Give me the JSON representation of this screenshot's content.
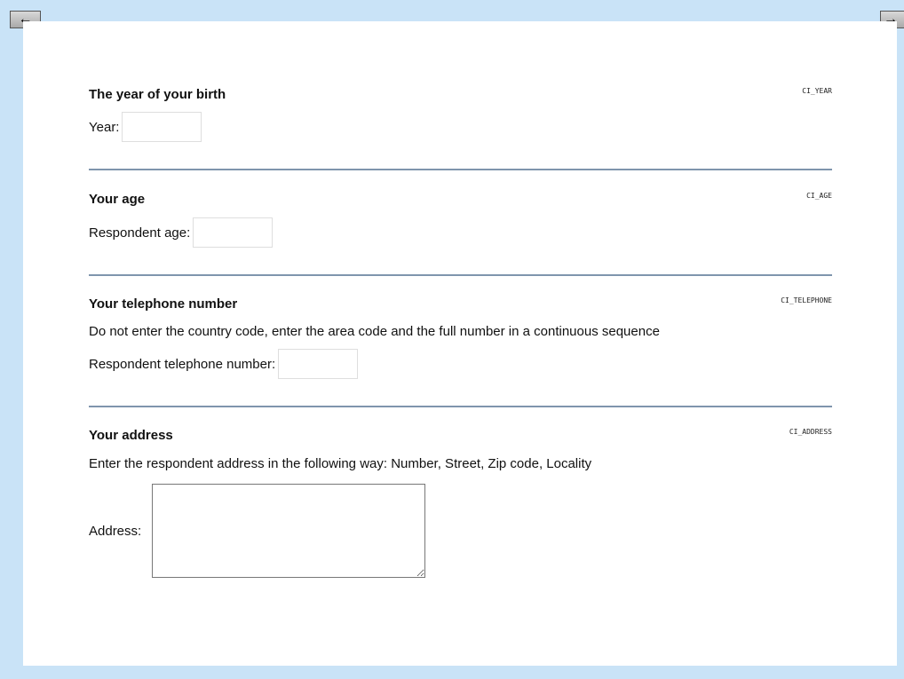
{
  "nav": {
    "prev_icon": "arrow-left-icon",
    "next_icon": "arrow-right-icon",
    "prev_glyph": "←",
    "next_glyph": "→"
  },
  "questions": {
    "year": {
      "title": "The year of your birth",
      "code": "CI_YEAR",
      "label": "Year:",
      "value": ""
    },
    "age": {
      "title": "Your age",
      "code": "CI_AGE",
      "label": "Respondent age:",
      "value": ""
    },
    "telephone": {
      "title": "Your telephone number",
      "code": "CI_TELEPHONE",
      "description": "Do not enter the country code, enter the area code and the full number in a continuous sequence",
      "label": "Respondent telephone number:",
      "value": ""
    },
    "address": {
      "title": "Your address",
      "code": "CI_ADDRESS",
      "description": "Enter the respondent address in the following way: Number, Street, Zip code, Locality",
      "label": "Address:",
      "value": ""
    }
  },
  "colors": {
    "background": "#c9e3f7",
    "page": "#ffffff",
    "divider": "#7f95ad"
  }
}
